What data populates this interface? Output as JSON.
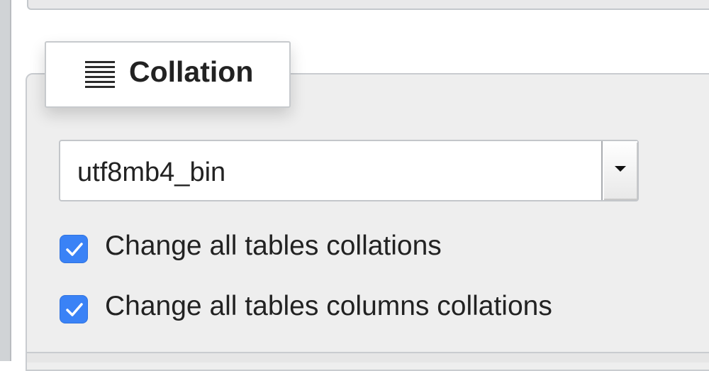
{
  "collation_section": {
    "legend_title": "Collation",
    "legend_icon": "list-icon",
    "select": {
      "value": "utf8mb4_bin"
    },
    "checkboxes": [
      {
        "label": "Change all tables collations",
        "checked": true
      },
      {
        "label": "Change all tables columns collations",
        "checked": true
      }
    ]
  },
  "colors": {
    "checkbox_accent": "#3a82f6",
    "panel_background": "#eeeeee"
  }
}
